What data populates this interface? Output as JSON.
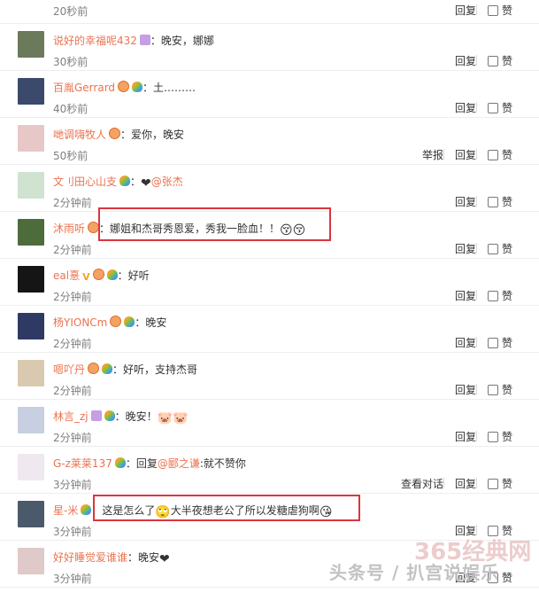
{
  "comments": [
    {
      "user": "",
      "badges": [],
      "text": "",
      "time": "20秒前",
      "report": ""
    },
    {
      "user": "说好的幸福呢432",
      "badges": [
        "crown"
      ],
      "text": "：晚安，娜娜",
      "time": "30秒前",
      "report": ""
    },
    {
      "user": "百胤Gerrard",
      "badges": [
        "vip",
        "heart"
      ],
      "text": "：土………",
      "time": "40秒前",
      "report": ""
    },
    {
      "user": "哋调嗨牧人",
      "badges": [
        "vip"
      ],
      "text": "：爱你，晚安",
      "time": "50秒前",
      "report": "举报"
    },
    {
      "user": "文刂田心山支",
      "badges": [
        "heart"
      ],
      "text": "：",
      "emoji_after": "❤",
      "mention": "@张杰",
      "time": "2分钟前",
      "report": ""
    },
    {
      "user": "沐雨听",
      "badges": [
        "vip"
      ],
      "text": "：娜姐和杰哥秀恩爱，秀我一脸血！！",
      "emoji_after": "😚😚",
      "time": "2分钟前",
      "report": ""
    },
    {
      "user": "eal憙",
      "badges": [
        "v",
        "vip",
        "heart"
      ],
      "text": "：好听",
      "time": "2分钟前",
      "report": ""
    },
    {
      "user": "杨YIONCm",
      "badges": [
        "vip",
        "heart"
      ],
      "text": "：晚安",
      "time": "2分钟前",
      "report": ""
    },
    {
      "user": "嗯吖丹",
      "badges": [
        "vip",
        "heart"
      ],
      "text": "：好听，支持杰哥",
      "time": "2分钟前",
      "report": ""
    },
    {
      "user": "林言_zj",
      "badges": [
        "crown",
        "heart"
      ],
      "text": "：晚安！",
      "emoji_after": "🐷🐷",
      "time": "2分钟前",
      "report": ""
    },
    {
      "user": "G-z莱莱137",
      "badges": [
        "heart"
      ],
      "text": "：回复",
      "mention": "@郾之谦",
      "text_after": ":就不赞你",
      "time": "3分钟前",
      "report": "",
      "extra": "查看对话"
    },
    {
      "user": "星-米",
      "badges": [
        "heart"
      ],
      "text": "：这是怎么了",
      "emoji_after": "🙄",
      "text_after": "大半夜想老公了所以发糖虐狗啊",
      "emoji_end": "😘",
      "time": "3分钟前",
      "report": ""
    },
    {
      "user": "好好睡觉爱谁谁",
      "badges": [],
      "text": "：晚安",
      "emoji_after": "❤",
      "time": "3分钟前",
      "report": ""
    }
  ],
  "labels": {
    "reply": "回复",
    "like": "赞"
  },
  "watermark": "头条号 / 扒宫说娱乐",
  "watermark_site": "365经典网",
  "colors": {
    "username": "#eb7350",
    "highlight": "#d9363e"
  }
}
